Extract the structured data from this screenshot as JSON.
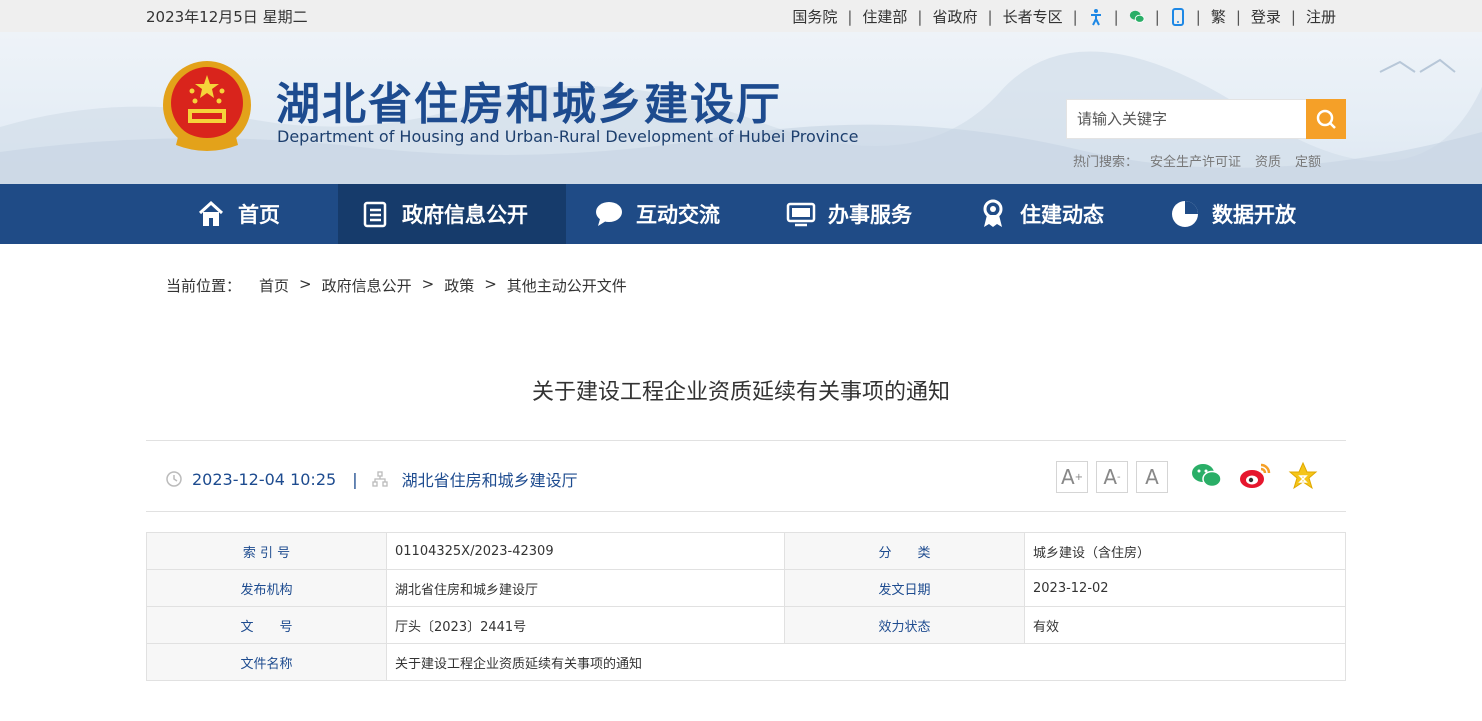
{
  "topbar": {
    "date": "2023年12月5日 星期二",
    "links": [
      "国务院",
      "住建部",
      "省政府",
      "长者专区",
      "繁",
      "登录",
      "注册"
    ]
  },
  "header": {
    "title": "湖北省住房和城乡建设厅",
    "subtitle": "Department of Housing and Urban-Rural Development of Hubei Province",
    "search_placeholder": "请输入关键字",
    "hot_label": "热门搜索：",
    "hot_terms": [
      "安全生产许可证",
      "资质",
      "定额"
    ]
  },
  "nav": {
    "items": [
      {
        "label": "首页",
        "icon": "home-icon"
      },
      {
        "label": "政府信息公开",
        "icon": "document-list-icon",
        "active": true
      },
      {
        "label": "互动交流",
        "icon": "chat-bubble-icon"
      },
      {
        "label": "办事服务",
        "icon": "monitor-icon"
      },
      {
        "label": "住建动态",
        "icon": "award-ribbon-icon"
      },
      {
        "label": "数据开放",
        "icon": "pie-chart-icon"
      }
    ]
  },
  "breadcrumb": {
    "label": "当前位置：",
    "items": [
      "首页",
      "政府信息公开",
      "政策",
      "其他主动公开文件"
    ],
    "separator": ">"
  },
  "article": {
    "title": "关于建设工程企业资质延续有关事项的通知",
    "datetime": "2023-12-04 10:25",
    "divider": "|",
    "source": "湖北省住房和城乡建设厅",
    "font_buttons": [
      "A",
      "A",
      "A"
    ]
  },
  "info_table": {
    "rows": [
      {
        "k1": "索 引 号",
        "v1": "01104325X/2023-42309",
        "k2": "分　　类",
        "v2": "城乡建设（含住房）"
      },
      {
        "k1": "发布机构",
        "v1": "湖北省住房和城乡建设厅",
        "k2": "发文日期",
        "v2": "2023-12-02"
      },
      {
        "k1": "文　　号",
        "v1": "厅头〔2023〕2441号",
        "k2": "效力状态",
        "v2": "有效"
      },
      {
        "k1": "文件名称",
        "v1": "关于建设工程企业资质延续有关事项的通知"
      }
    ]
  },
  "colors": {
    "nav_bg": "#1f4b86",
    "nav_active": "#163b6b",
    "accent_orange": "#f5a028",
    "link_blue": "#1d4b8f"
  }
}
